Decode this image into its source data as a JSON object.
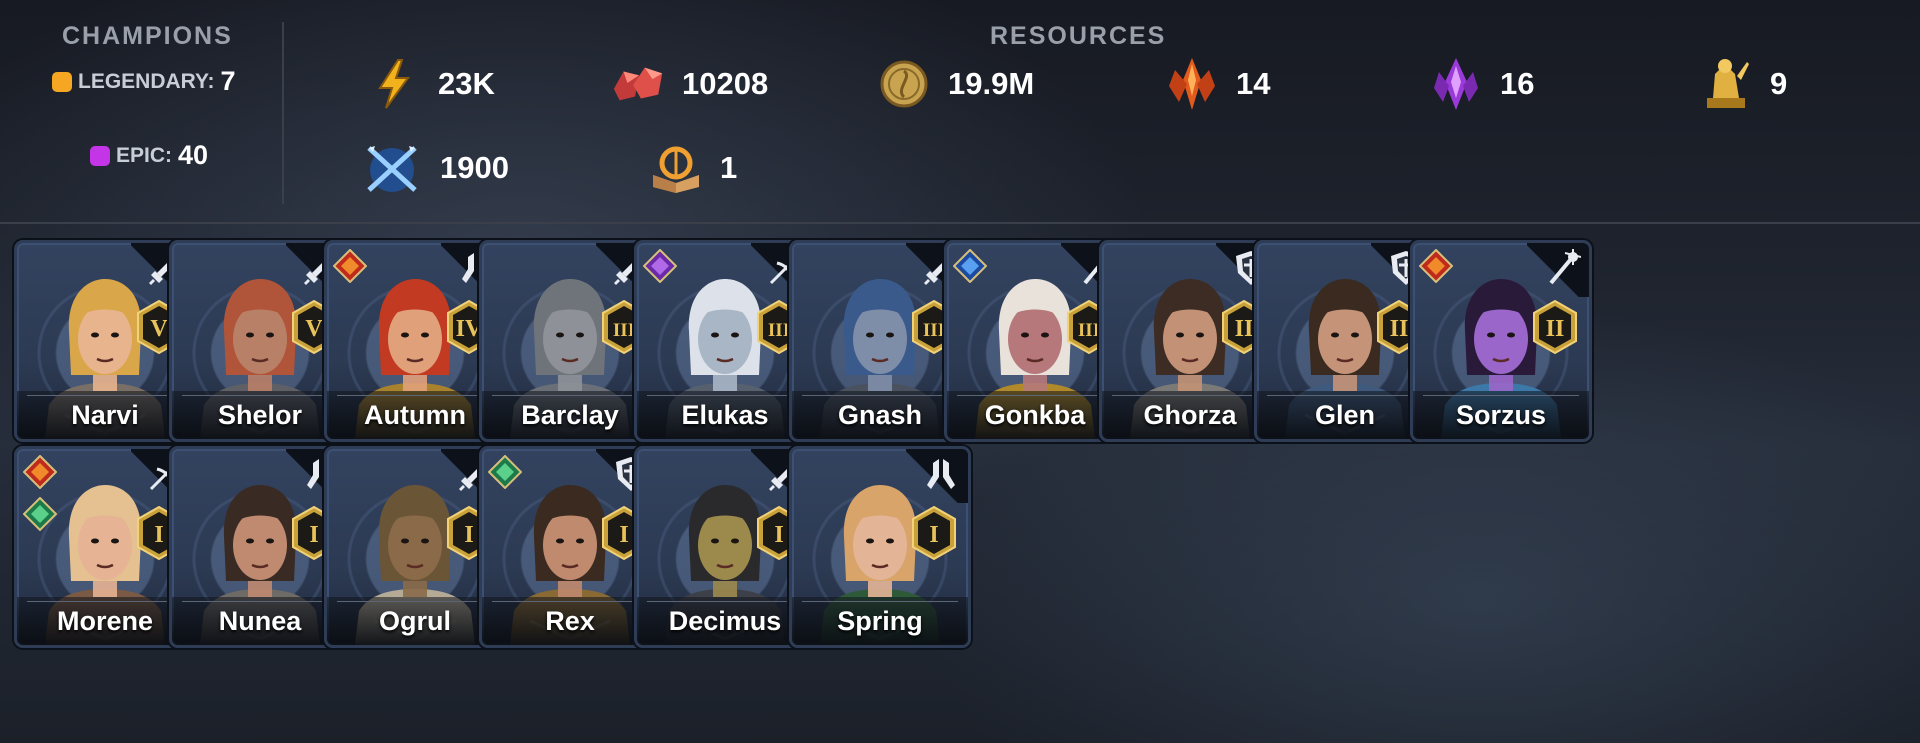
{
  "champions": {
    "title": "CHAMPIONS",
    "legendary": {
      "label": "LEGENDARY:",
      "count": "7",
      "color": "#f5a623"
    },
    "epic": {
      "label": "EPIC:",
      "count": "40",
      "color": "#c535e8"
    }
  },
  "resources": {
    "title": "RESOURCES",
    "items": [
      {
        "icon": "energy-icon",
        "value": "23K"
      },
      {
        "icon": "ruby-icon",
        "value": "10208"
      },
      {
        "icon": "silver-coin-icon",
        "value": "19.9M"
      },
      {
        "icon": "ancient-shard-icon",
        "value": "14"
      },
      {
        "icon": "void-shard-icon",
        "value": "16"
      },
      {
        "icon": "gold-statue-icon",
        "value": "9"
      },
      {
        "icon": "arena-tokens-icon",
        "value": "1900"
      },
      {
        "icon": "tome-icon",
        "value": "1"
      }
    ]
  },
  "roster": [
    {
      "name": "Narvi",
      "role": "attack-icon",
      "rank": "V",
      "affinity": [],
      "theme": {
        "skin": "#e8b48e",
        "hair": "#d9a64a",
        "armor": "#7a6f66"
      }
    },
    {
      "name": "Shelor",
      "role": "attack-icon",
      "rank": "V",
      "affinity": [],
      "theme": {
        "skin": "#b98068",
        "hair": "#b0543a",
        "armor": "#5e6066"
      }
    },
    {
      "name": "Autumn",
      "role": "support-icon",
      "rank": "IV",
      "affinity": [
        "force-affinity-icon"
      ],
      "theme": {
        "skin": "#e0a07a",
        "hair": "#c23a22",
        "armor": "#a8822c"
      }
    },
    {
      "name": "Barclay",
      "role": "attack-icon",
      "rank": "III",
      "affinity": [],
      "theme": {
        "skin": "#8e9298",
        "hair": "#6f747b",
        "armor": "#6a6f78"
      }
    },
    {
      "name": "Elukas",
      "role": "hp-icon",
      "rank": "III",
      "affinity": [
        "void-affinity-icon"
      ],
      "theme": {
        "skin": "#a9b6c6",
        "hair": "#dde2ea",
        "armor": "#56606e"
      }
    },
    {
      "name": "Gnash",
      "role": "attack-icon",
      "rank": "III",
      "affinity": [],
      "theme": {
        "skin": "#7f8ea8",
        "hair": "#3b5a8c",
        "armor": "#4a5260"
      }
    },
    {
      "name": "Gonkba",
      "role": "defense-icon",
      "rank": "III",
      "affinity": [
        "magic-affinity-icon"
      ],
      "theme": {
        "skin": "#b6787a",
        "hair": "#e9e2da",
        "armor": "#b08a2a"
      }
    },
    {
      "name": "Ghorza",
      "role": "shield-icon",
      "rank": "II",
      "affinity": [],
      "theme": {
        "skin": "#c39276",
        "hair": "#3c2c24",
        "armor": "#7c7a76"
      }
    },
    {
      "name": "Glen",
      "role": "shield-icon",
      "rank": "II",
      "affinity": [],
      "theme": {
        "skin": "#c59478",
        "hair": "#3a2a20",
        "armor": "#3f5a7c"
      }
    },
    {
      "name": "Sorzus",
      "role": "defense-icon",
      "rank": "II",
      "affinity": [
        "force-affinity-icon"
      ],
      "theme": {
        "skin": "#9a66c9",
        "hair": "#2a1a3a",
        "armor": "#3c78a8"
      }
    },
    {
      "name": "Morene",
      "role": "hp-icon",
      "rank": "I",
      "affinity": [
        "force-affinity-icon",
        "spirit-affinity-icon"
      ],
      "theme": {
        "skin": "#e6b394",
        "hair": "#e5c090",
        "armor": "#7a5a44"
      }
    },
    {
      "name": "Nunea",
      "role": "support-icon",
      "rank": "I",
      "affinity": [],
      "theme": {
        "skin": "#bf8a70",
        "hair": "#3a2a24",
        "armor": "#6e6a66"
      }
    },
    {
      "name": "Ogrul",
      "role": "attack-icon",
      "rank": "I",
      "affinity": [],
      "theme": {
        "skin": "#8a6a48",
        "hair": "#6a5536",
        "armor": "#b5aa96"
      }
    },
    {
      "name": "Rex",
      "role": "shield-icon",
      "rank": "I",
      "affinity": [
        "spirit-affinity-icon"
      ],
      "theme": {
        "skin": "#c08a6e",
        "hair": "#3a2a20",
        "armor": "#8a6a34"
      }
    },
    {
      "name": "Decimus",
      "role": "attack-icon",
      "rank": "I",
      "affinity": [],
      "theme": {
        "skin": "#9c8a4c",
        "hair": "#2a2a2c",
        "armor": "#3d4048"
      }
    },
    {
      "name": "Spring",
      "role": "support-icon",
      "rank": "I",
      "affinity": [],
      "theme": {
        "skin": "#e3b496",
        "hair": "#d8a46a",
        "armor": "#2f5a3a"
      }
    }
  ]
}
